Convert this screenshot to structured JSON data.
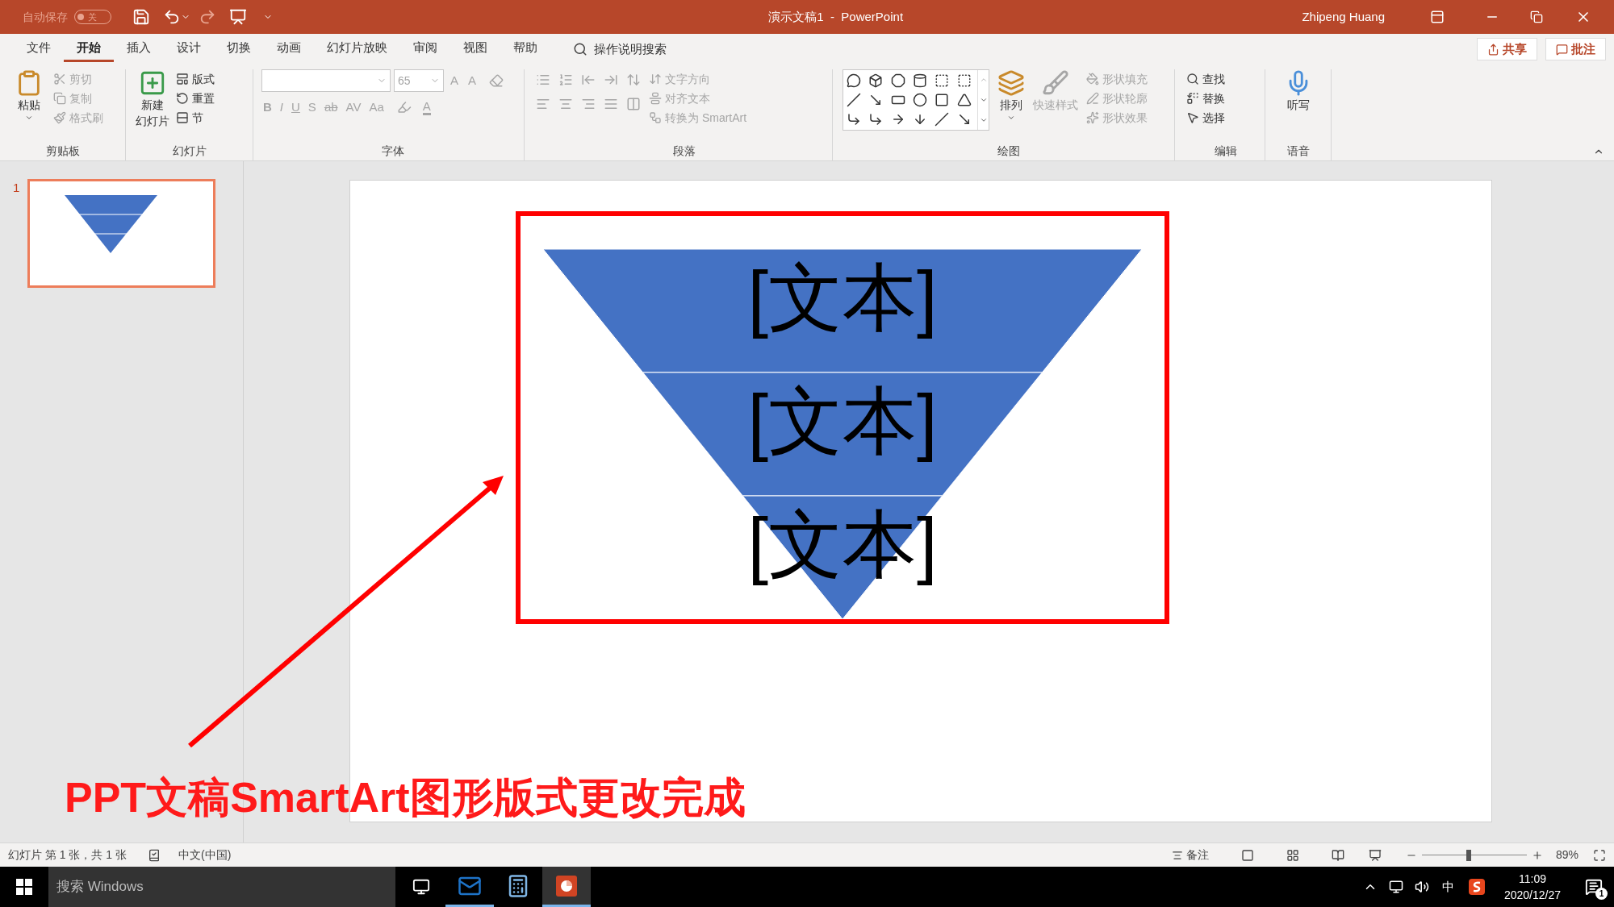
{
  "title_bar": {
    "autosave": {
      "label": "自动保存",
      "state_text": "关",
      "on": false
    },
    "document_title": "演示文稿1  -  PowerPoint",
    "user": "Zhipeng Huang"
  },
  "ribbon_tabs": [
    {
      "label": "文件",
      "selected": false
    },
    {
      "label": "开始",
      "selected": true
    },
    {
      "label": "插入",
      "selected": false
    },
    {
      "label": "设计",
      "selected": false
    },
    {
      "label": "切换",
      "selected": false
    },
    {
      "label": "动画",
      "selected": false
    },
    {
      "label": "幻灯片放映",
      "selected": false
    },
    {
      "label": "审阅",
      "selected": false
    },
    {
      "label": "视图",
      "selected": false
    },
    {
      "label": "帮助",
      "selected": false
    }
  ],
  "tell_me": "操作说明搜索",
  "share_button": "共享",
  "comments_button": "批注",
  "ribbon": {
    "clipboard": {
      "paste": "粘贴",
      "commands": [
        {
          "label": "剪切",
          "disabled": true
        },
        {
          "label": "复制",
          "disabled": true
        },
        {
          "label": "格式刷",
          "disabled": true
        }
      ],
      "label": "剪贴板"
    },
    "slides": {
      "new_slide_lines": [
        "新建",
        "幻灯片"
      ],
      "commands": [
        {
          "label": "版式",
          "disabled": false
        },
        {
          "label": "重置",
          "disabled": false
        },
        {
          "label": "节",
          "disabled": false
        }
      ],
      "label": "幻灯片"
    },
    "font": {
      "font_size": "65",
      "size_buttons": [
        "A",
        "A"
      ],
      "format_buttons": [
        "B",
        "I",
        "U",
        "S",
        "ab",
        "AV",
        "Aa"
      ],
      "color_button": "A",
      "disabled": true,
      "label": "字体"
    },
    "paragraph": {
      "commands": [
        {
          "label": "文字方向",
          "disabled": true
        },
        {
          "label": "对齐文本",
          "disabled": true
        },
        {
          "label": "转换为 SmartArt",
          "disabled": true
        }
      ],
      "label": "段落"
    },
    "drawing": {
      "arrange": "排列",
      "quick_styles": {
        "label": "快速样式",
        "disabled": true
      },
      "commands": [
        {
          "label": "形状填充",
          "disabled": true
        },
        {
          "label": "形状轮廓",
          "disabled": true
        },
        {
          "label": "形状效果",
          "disabled": true
        }
      ],
      "label": "绘图"
    },
    "editing": {
      "commands": [
        {
          "label": "查找",
          "disabled": false
        },
        {
          "label": "替换",
          "disabled": false
        },
        {
          "label": "选择",
          "disabled": false
        }
      ],
      "label": "编辑"
    },
    "voice": {
      "dictate": "听写",
      "label": "语音"
    }
  },
  "thumbnails": [
    {
      "number": "1",
      "selected": true
    }
  ],
  "slide": {
    "funnel": [
      "[文本]",
      "[文本]",
      "[文本]"
    ]
  },
  "caption": "PPT文稿SmartArt图形版式更改完成",
  "status_bar": {
    "slide_info": "幻灯片 第 1 张，共 1 张",
    "language": "中文(中国)",
    "notes": "备注",
    "zoom": {
      "level": 0.45,
      "reading": "89%"
    }
  },
  "taskbar": {
    "search_placeholder": "搜索 Windows",
    "apps": [
      {
        "kind": "outlook",
        "running": true,
        "selected": false
      },
      {
        "kind": "calculator",
        "running": false,
        "selected": false
      },
      {
        "kind": "powerpoint",
        "running": true,
        "selected": true
      }
    ],
    "ime": "中",
    "time": "11:09",
    "date": "2020/12/27",
    "notifications": "1"
  }
}
